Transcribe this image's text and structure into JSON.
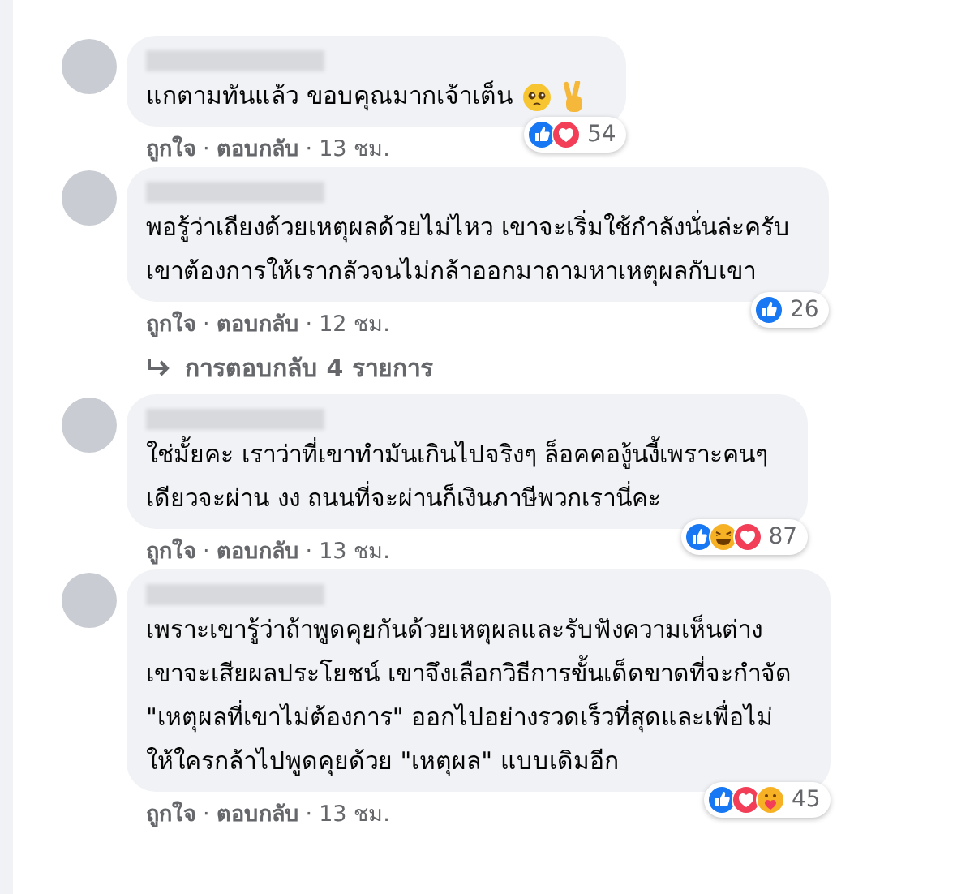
{
  "separator": "·",
  "comments": [
    {
      "text": "แกตามทันแล้ว ขอบคุณมากเจ้าเต็น",
      "emojis": [
        {
          "kind": "pleading"
        },
        {
          "kind": "victory"
        }
      ],
      "actions": [
        "ถูกใจ",
        "ตอบกลับ"
      ],
      "time": "13 ชม.",
      "reactions": [
        {
          "kind": "like"
        },
        {
          "kind": "love"
        }
      ],
      "reaction_count": "54"
    },
    {
      "text": "พอรู้ว่าเถียงด้วยเหตุผลด้วยไม่ไหว เขาจะเริ่มใช้กำลังนั่นล่ะครับ\nเขาต้องการให้เรากลัวจนไม่กล้าออกมาถามหาเหตุผลกับเขา",
      "actions": [
        "ถูกใจ",
        "ตอบกลับ"
      ],
      "time": "12 ชม.",
      "reactions": [
        {
          "kind": "like"
        }
      ],
      "reaction_count": "26",
      "replies_link": "การตอบกลับ 4 รายการ"
    },
    {
      "text": "ใช่มั้ยคะ เราว่าที่เขาทำมันเกินไปจริงๆ ล็อคคองู้นงี้เพราะคนๆ\nเดียวจะผ่าน งง ถนนที่จะผ่านก็เงินภาษีพวกเรานี่คะ",
      "actions": [
        "ถูกใจ",
        "ตอบกลับ"
      ],
      "time": "13 ชม.",
      "reactions": [
        {
          "kind": "like"
        },
        {
          "kind": "haha"
        },
        {
          "kind": "love"
        }
      ],
      "reaction_count": "87"
    },
    {
      "text": "เพราะเขารู้ว่าถ้าพูดคุยกันด้วยเหตุผลและรับฟังความเห็นต่าง\nเขาจะเสียผลประโยชน์ เขาจึงเลือกวิธีการขั้นเด็ดขาดที่จะกำจัด\n\"เหตุผลที่เขาไม่ต้องการ\" ออกไปอย่างรวดเร็วที่สุดและเพื่อไม่\nให้ใครกล้าไปพูดคุยด้วย \"เหตุผล\" แบบเดิมอีก",
      "actions": [
        "ถูกใจ",
        "ตอบกลับ"
      ],
      "time": "13 ชม.",
      "reactions": [
        {
          "kind": "like"
        },
        {
          "kind": "love"
        },
        {
          "kind": "care"
        }
      ],
      "reaction_count": "45"
    }
  ]
}
